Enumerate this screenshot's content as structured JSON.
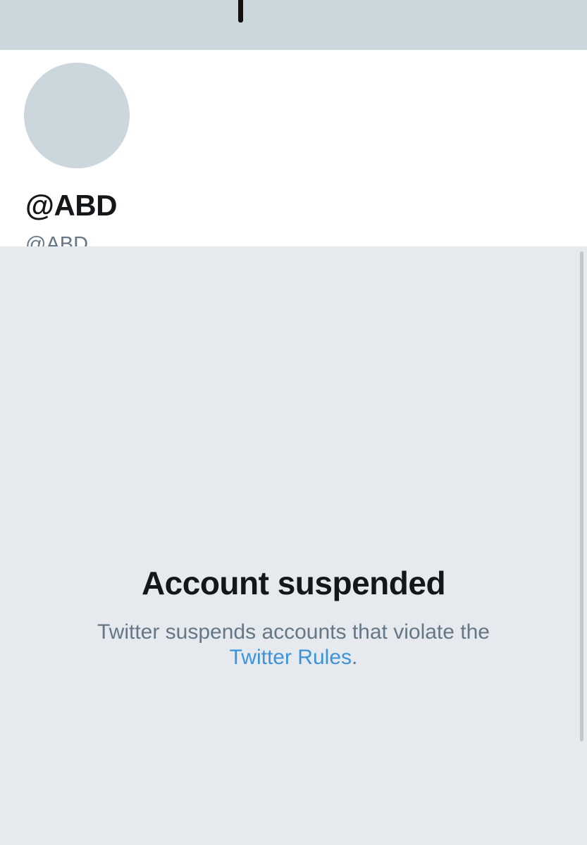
{
  "profile": {
    "display_name": "@ABD",
    "handle": "@ABD"
  },
  "suspension": {
    "title": "Account suspended",
    "message_prefix": "Twitter suspends accounts that violate the",
    "rules_link": "Twitter Rules",
    "message_suffix": "."
  },
  "colors": {
    "banner": "#ccd6dd",
    "avatar_placeholder": "#ccd6dd",
    "page_background": "#e6e9ee",
    "primary_text": "#14171a",
    "secondary_text": "#657786",
    "link": "#3b94d9"
  }
}
